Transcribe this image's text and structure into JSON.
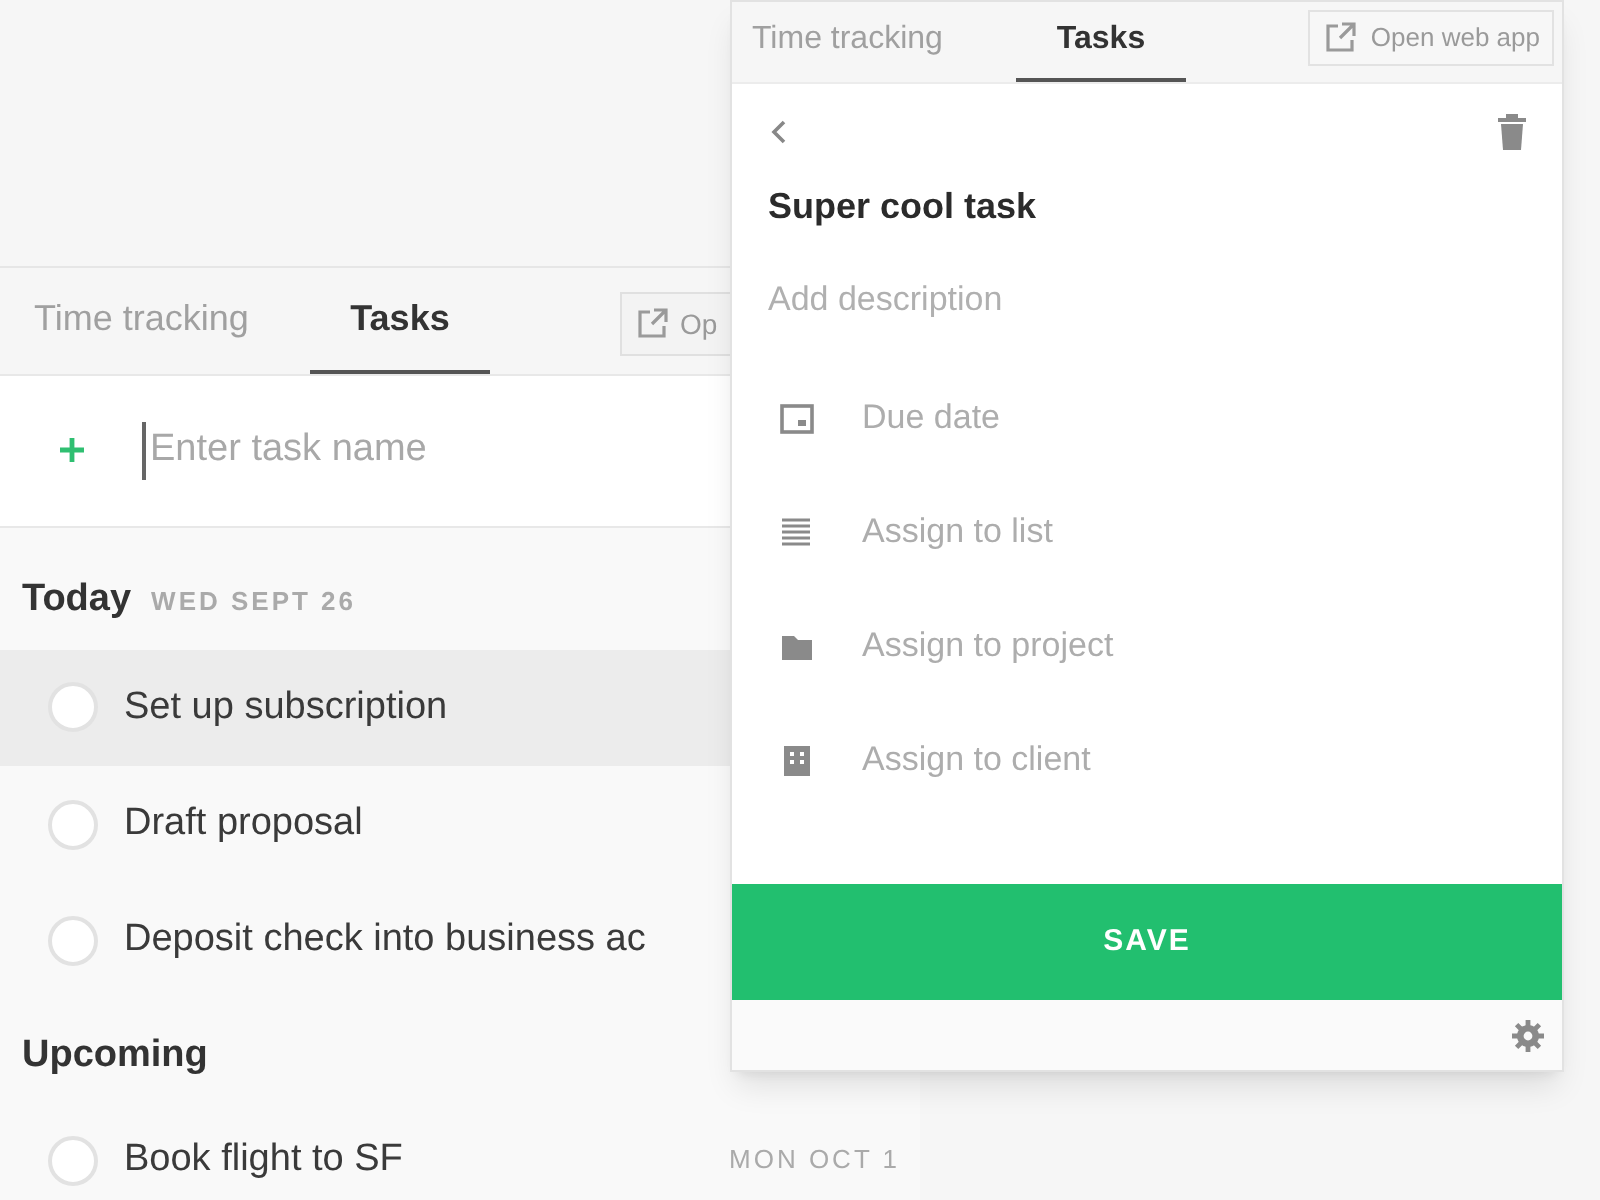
{
  "left_panel": {
    "tabs": [
      {
        "label": "Time tracking",
        "selected": false
      },
      {
        "label": "Tasks",
        "selected": true
      }
    ],
    "open_button": {
      "label": "Op"
    },
    "new_task": {
      "placeholder": "Enter task name"
    },
    "sections": [
      {
        "title": "Today",
        "date": "WED SEPT 26",
        "tasks": [
          {
            "name": "Set up subscription",
            "checked": false,
            "highlighted": true
          },
          {
            "name": "Draft proposal",
            "checked": false,
            "highlighted": false
          },
          {
            "name": "Deposit check into business ac",
            "checked": false,
            "highlighted": false
          }
        ]
      },
      {
        "title": "Upcoming",
        "tasks": [
          {
            "name": "Book flight to SF",
            "date": "MON OCT 1",
            "checked": false,
            "highlighted": false
          }
        ]
      }
    ]
  },
  "task_editor": {
    "tabs": [
      {
        "label": "Time tracking",
        "selected": false
      },
      {
        "label": "Tasks",
        "selected": true
      }
    ],
    "open_button": {
      "label": "Open web app"
    },
    "title": "Super cool task",
    "description": {
      "placeholder": "Add description"
    },
    "fields": [
      {
        "kind": "date",
        "label": "Due date"
      },
      {
        "kind": "list",
        "label": "Assign to list"
      },
      {
        "kind": "project",
        "label": "Assign to project"
      },
      {
        "kind": "client",
        "label": "Assign to client"
      }
    ],
    "save_button": "SAVE"
  }
}
